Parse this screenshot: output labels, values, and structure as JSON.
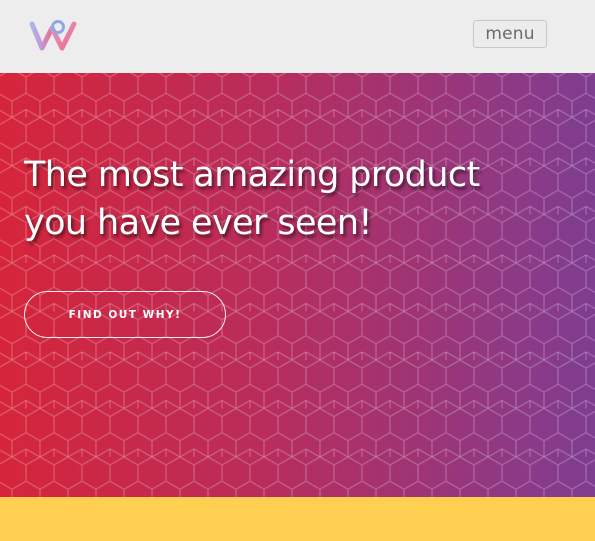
{
  "header": {
    "logo_icon": "w-logo-icon",
    "menu_label": "menu"
  },
  "hero": {
    "title": "The most amazing product you have ever seen!",
    "cta_label": "FIND OUT WHY!",
    "pattern_icon": "hexagon-pattern",
    "gradient_start": "#d6253a",
    "gradient_end": "#7e3d8f"
  },
  "footer": {
    "band_color": "#ffcf52"
  }
}
